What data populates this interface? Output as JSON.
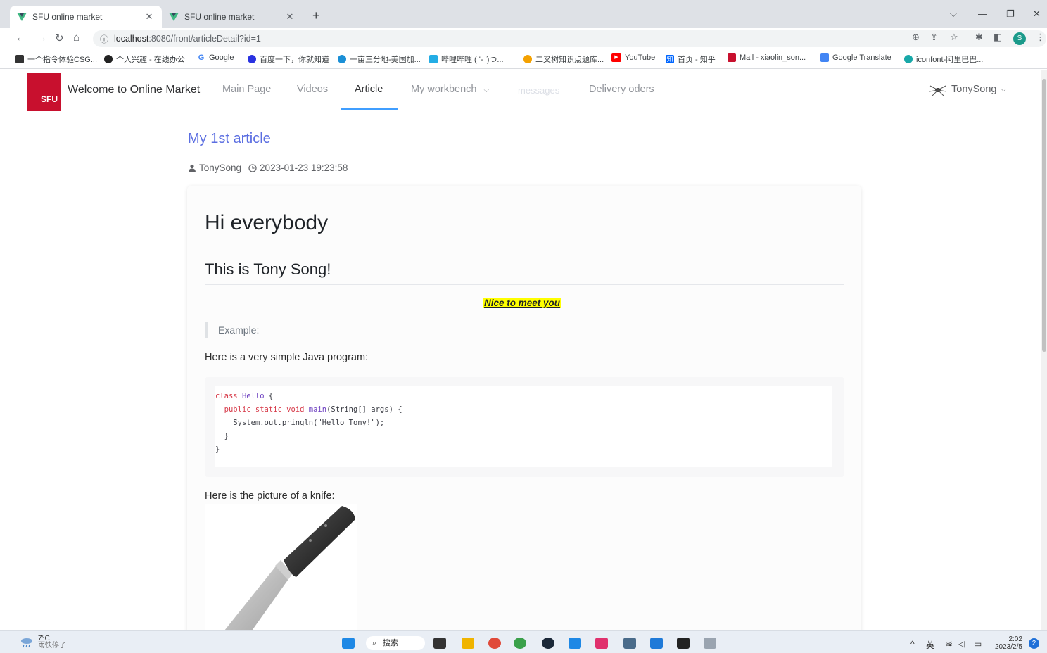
{
  "browser": {
    "tabs": [
      {
        "title": "SFU online market",
        "active": true
      },
      {
        "title": "SFU online market",
        "active": false
      }
    ],
    "new_tab": "+",
    "url_host": "localhost",
    "url_rest": ":8080/front/articleDetail?id=1",
    "bookmarks": [
      {
        "label": "一个指令体验CSG...",
        "color": "#333333"
      },
      {
        "label": "个人兴趣 - 在线办公",
        "color": "#222222"
      },
      {
        "label": "Google",
        "color": "#4285f4"
      },
      {
        "label": "百度一下，你就知道",
        "color": "#2932e1"
      },
      {
        "label": "一亩三分地-美国加...",
        "color": "#1a8fd6"
      },
      {
        "label": "哔哩哔哩 ( '- ')つ...",
        "color": "#23ade5"
      },
      {
        "label": "二叉树知识点题库...",
        "color": "#f4a100"
      },
      {
        "label": "YouTube",
        "color": "#ff0000"
      },
      {
        "label": "首页 - 知乎",
        "color": "#0066ff"
      },
      {
        "label": "Mail - xiaolin_son...",
        "color": "#c8102e"
      },
      {
        "label": "Google Translate",
        "color": "#4285f4"
      },
      {
        "label": "iconfont-阿里巴巴...",
        "color": "#18a8a8"
      }
    ],
    "profile_initial": "S"
  },
  "nav": {
    "logo_text": "SFU",
    "brand": "Welcome to Online Market",
    "items": [
      "Main Page",
      "Videos",
      "Article",
      "My workbench",
      "messages",
      "Delivery oders"
    ],
    "active_item": "Article",
    "user": "TonySong"
  },
  "article": {
    "title": "My 1st article",
    "author": "TonySong",
    "date": "2023-01-23 19:23:58",
    "h1": "Hi everybody",
    "h2": "This is Tony Song!",
    "highlight": "Nice to meet you",
    "quote": "Example:",
    "para1": "Here is a very simple Java program:",
    "code_lines": [
      "class Hello {",
      "  public static void main(String[] args) {",
      "    System.out.pringln(\"Hello Tony!\");",
      "  }",
      "}"
    ],
    "para2": "Here is the picture of a knife:"
  },
  "taskbar": {
    "temperature": "7°C",
    "weather": "雨快停了",
    "search": "搜索",
    "lang": "英",
    "time": "2:02",
    "date": "2023/2/5",
    "notifications": "2"
  },
  "colors": {
    "accent": "#409eff",
    "title_link": "#5b6ee1",
    "logo_red": "#c8102e",
    "highlight": "#ffff00"
  }
}
